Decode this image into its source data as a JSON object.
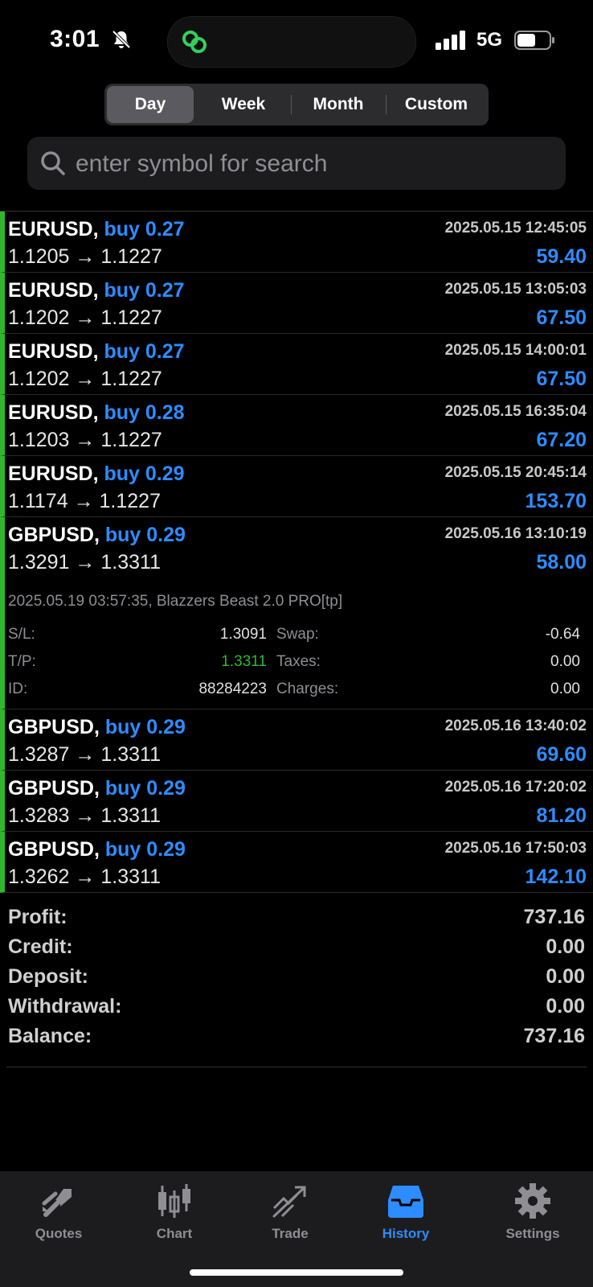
{
  "status_bar": {
    "time": "3:01",
    "network": "5G"
  },
  "period_tabs": [
    {
      "label": "Day",
      "active": true
    },
    {
      "label": "Week",
      "active": false
    },
    {
      "label": "Month",
      "active": false
    },
    {
      "label": "Custom",
      "active": false
    }
  ],
  "search": {
    "placeholder": "enter symbol for search",
    "value": ""
  },
  "deals": [
    {
      "symbol": "EURUSD,",
      "side": "buy 0.27",
      "datetime": "2025.05.15 12:45:05",
      "open_price": "1.1205",
      "close_price": "1.1227",
      "profit": "59.40"
    },
    {
      "symbol": "EURUSD,",
      "side": "buy 0.27",
      "datetime": "2025.05.15 13:05:03",
      "open_price": "1.1202",
      "close_price": "1.1227",
      "profit": "67.50"
    },
    {
      "symbol": "EURUSD,",
      "side": "buy 0.27",
      "datetime": "2025.05.15 14:00:01",
      "open_price": "1.1202",
      "close_price": "1.1227",
      "profit": "67.50"
    },
    {
      "symbol": "EURUSD,",
      "side": "buy 0.28",
      "datetime": "2025.05.15 16:35:04",
      "open_price": "1.1203",
      "close_price": "1.1227",
      "profit": "67.20"
    },
    {
      "symbol": "EURUSD,",
      "side": "buy 0.29",
      "datetime": "2025.05.15 20:45:14",
      "open_price": "1.1174",
      "close_price": "1.1227",
      "profit": "153.70"
    },
    {
      "symbol": "GBPUSD,",
      "side": "buy 0.29",
      "datetime": "2025.05.16 13:10:19",
      "open_price": "1.3291",
      "close_price": "1.3311",
      "profit": "58.00"
    },
    {
      "symbol": "GBPUSD,",
      "side": "buy 0.29",
      "datetime": "2025.05.16 13:40:02",
      "open_price": "1.3287",
      "close_price": "1.3311",
      "profit": "69.60"
    },
    {
      "symbol": "GBPUSD,",
      "side": "buy 0.29",
      "datetime": "2025.05.16 17:20:02",
      "open_price": "1.3283",
      "close_price": "1.3311",
      "profit": "81.20"
    },
    {
      "symbol": "GBPUSD,",
      "side": "buy 0.29",
      "datetime": "2025.05.16 17:50:03",
      "open_price": "1.3262",
      "close_price": "1.3311",
      "profit": "142.10"
    }
  ],
  "arrow": "→",
  "expanded_detail": {
    "line": "2025.05.19 03:57:35, Blazzers Beast 2.0 PRO[tp]",
    "sl_label": "S/L:",
    "sl_value": "1.3091",
    "tp_label": "T/P:",
    "tp_value": "1.3311",
    "id_label": "ID:",
    "id_value": "88284223",
    "swap_label": "Swap:",
    "swap_value": "-0.64",
    "taxes_label": "Taxes:",
    "taxes_value": "0.00",
    "charges_label": "Charges:",
    "charges_value": "0.00"
  },
  "summary": [
    {
      "label": "Profit:",
      "value": "737.16"
    },
    {
      "label": "Credit:",
      "value": "0.00"
    },
    {
      "label": "Deposit:",
      "value": "0.00"
    },
    {
      "label": "Withdrawal:",
      "value": "0.00"
    },
    {
      "label": "Balance:",
      "value": "737.16"
    }
  ],
  "tabbar": [
    {
      "label": "Quotes",
      "icon": "quotes-icon",
      "active": false
    },
    {
      "label": "Chart",
      "icon": "candlestick-icon",
      "active": false
    },
    {
      "label": "Trade",
      "icon": "trade-icon",
      "active": false
    },
    {
      "label": "History",
      "icon": "inbox-icon",
      "active": true
    },
    {
      "label": "Settings",
      "icon": "gear-icon",
      "active": false
    }
  ],
  "colors": {
    "accent_blue": "#2d8cff",
    "profit_green": "#2eb82e",
    "background": "#000000"
  }
}
